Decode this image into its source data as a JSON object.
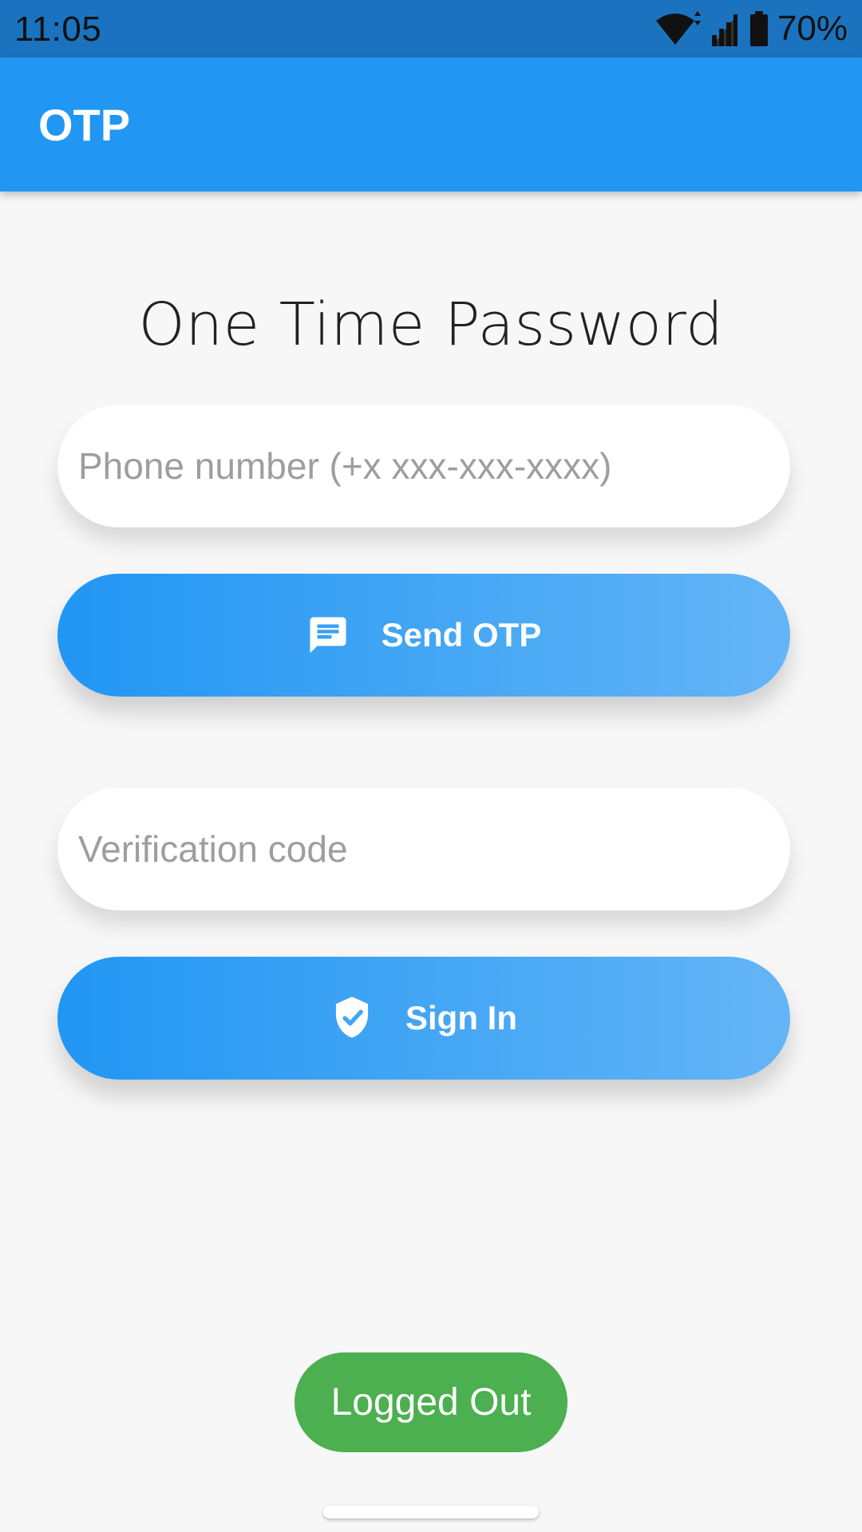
{
  "status_bar": {
    "time": "11:05",
    "battery_percent": "70%",
    "icons": [
      "wifi-icon",
      "signal-icon",
      "battery-icon"
    ],
    "background_color": "#1b73bf"
  },
  "app_bar": {
    "title": "OTP",
    "background_color": "#2196f3"
  },
  "main": {
    "heading": "One Time Password",
    "phone_input": {
      "placeholder": "Phone number (+x xxx-xxx-xxxx)",
      "value": ""
    },
    "send_button": {
      "label": "Send OTP",
      "icon": "message-icon"
    },
    "code_input": {
      "placeholder": "Verification code",
      "value": ""
    },
    "signin_button": {
      "label": "Sign In",
      "icon": "shield-check-icon"
    },
    "button_gradient": [
      "#2196f3",
      "#64b5f6"
    ]
  },
  "status": {
    "label": "Logged Out",
    "color": "#4caf50"
  }
}
